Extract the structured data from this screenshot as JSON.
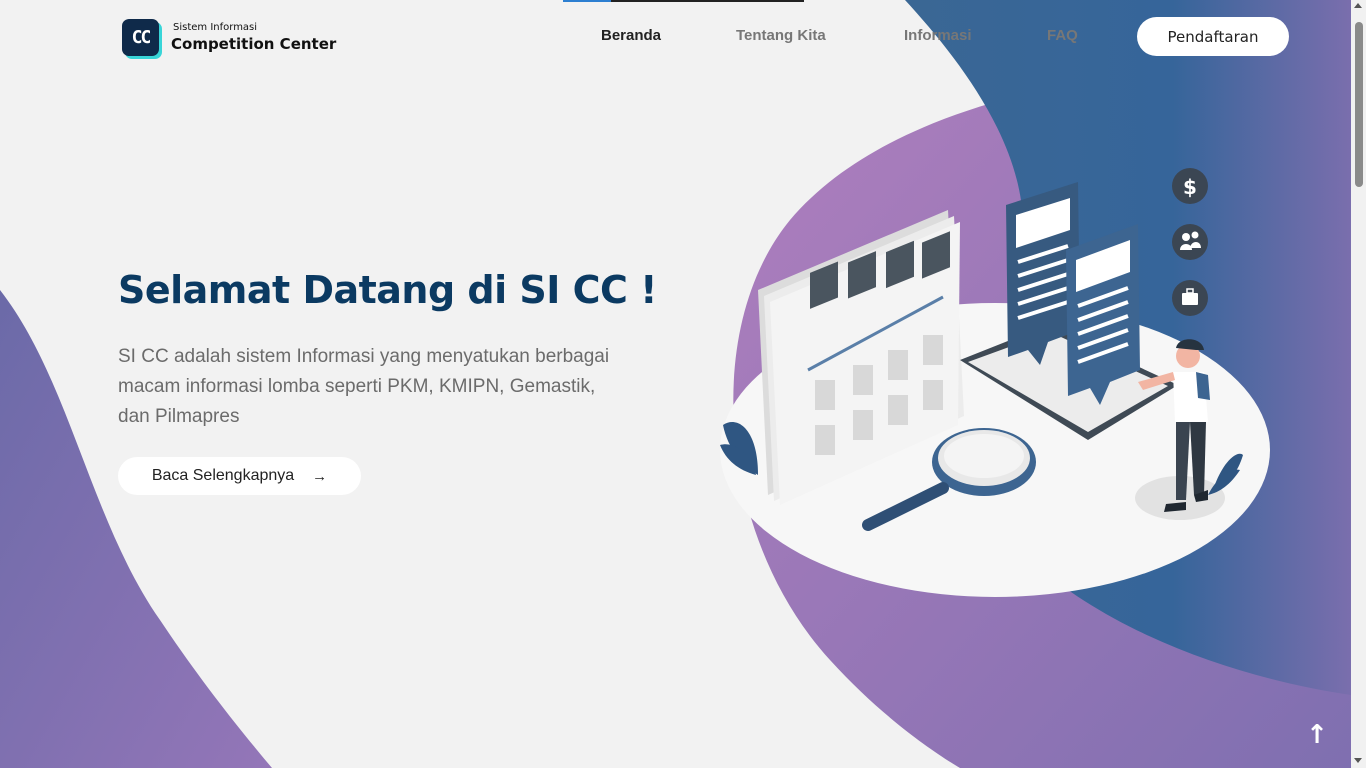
{
  "logo": {
    "badge": "CC",
    "small": "Sistem Informasi",
    "big": "Competition Center"
  },
  "nav": {
    "items": [
      {
        "label": "Beranda",
        "active": true
      },
      {
        "label": "Tentang Kita",
        "active": false
      },
      {
        "label": "Informasi",
        "active": false
      },
      {
        "label": "FAQ",
        "active": false
      }
    ],
    "register_label": "Pendaftaran"
  },
  "hero": {
    "title": "Selamat Datang di SI CC !",
    "description": "SI CC adalah sistem Informasi yang menyatukan berbagai macam informasi lomba seperti PKM, KMIPN, Gemastik, dan Pilmapres",
    "read_more_label": "Baca Selengkapnya",
    "read_more_icon": "arrow-right-icon"
  },
  "back_to_top_icon": "arrow-up-icon",
  "colors": {
    "title": "#0b3a62",
    "purple": "#a77bbd",
    "blue": "#336596",
    "accent": "#38d5d8"
  }
}
